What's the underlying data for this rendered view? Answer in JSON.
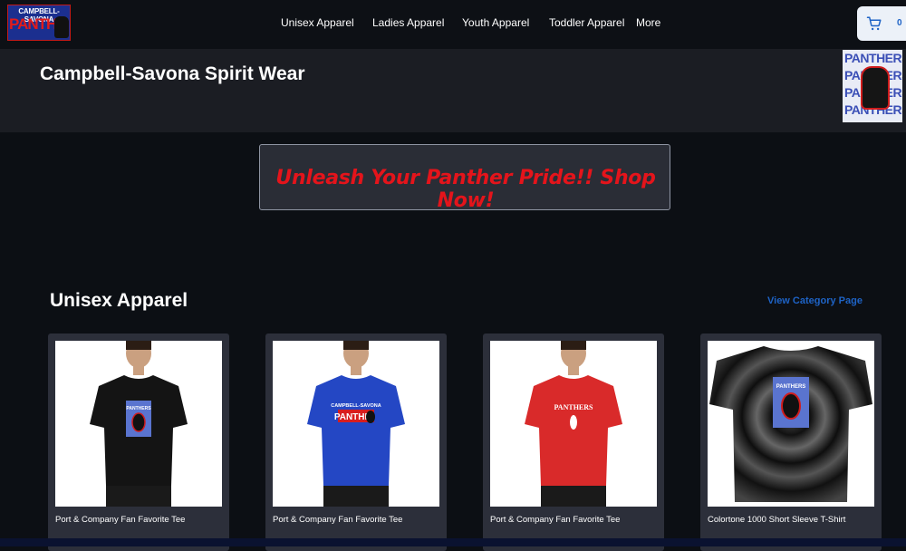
{
  "logo": {
    "top_text": "CAMPBELL-SAVONA",
    "main_text": "PANTHE"
  },
  "nav": {
    "items": [
      {
        "label": "Unisex Apparel"
      },
      {
        "label": "Ladies Apparel"
      },
      {
        "label": "Youth Apparel"
      },
      {
        "label": "Toddler Apparel"
      },
      {
        "label": "More"
      }
    ]
  },
  "cart": {
    "count": "0",
    "icon": "shopping-cart-icon"
  },
  "header": {
    "title": "Campbell-Savona Spirit Wear",
    "logo_words": [
      "PANTHERS",
      "PANTHERS",
      "PANTHERS",
      "PANTHERS"
    ]
  },
  "promo": {
    "text": "Unleash Your Panther Pride!! Shop Now!"
  },
  "section": {
    "title": "Unisex Apparel",
    "link": "View Category Page",
    "products": [
      {
        "name": "Port & Company Fan Favorite Tee",
        "shirt_color": "#141414",
        "print_text": "PANTHERS"
      },
      {
        "name": "Port & Company Fan Favorite Tee",
        "shirt_color": "#2447c4",
        "print_text": "CAMPBELL-SAVONA"
      },
      {
        "name": "Port & Company Fan Favorite Tee",
        "shirt_color": "#d92a2a",
        "print_text": "PANTHERS"
      },
      {
        "name": "Colortone 1000 Short Sleeve T-Shirt",
        "shirt_color": "#1a1a1e",
        "print_text": "PANTHERS"
      }
    ]
  },
  "colors": {
    "accent": "#1e63c6",
    "promo_red": "#e4141b",
    "background": "#0c0f14"
  }
}
